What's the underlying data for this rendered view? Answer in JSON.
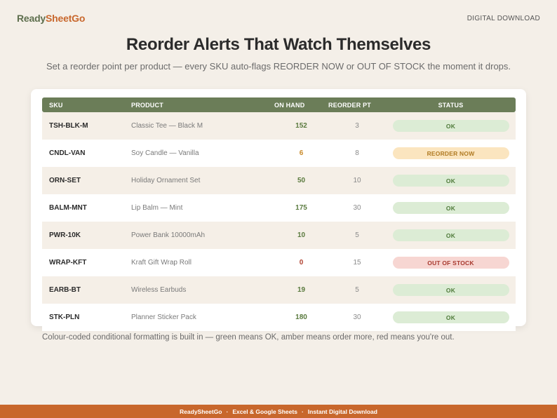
{
  "brand": {
    "part1": "Ready",
    "part2": "SheetGo"
  },
  "top_right": "DIGITAL DOWNLOAD",
  "headline": "Reorder Alerts That Watch Themselves",
  "subline": "Set a reorder point per product — every SKU auto-flags REORDER NOW or OUT OF STOCK the moment it drops.",
  "table": {
    "headers": {
      "sku": "SKU",
      "product": "PRODUCT",
      "on_hand": "ON HAND",
      "reorder_pt": "REORDER PT",
      "status": "STATUS"
    },
    "rows": [
      {
        "sku": "TSH-BLK-M",
        "product": "Classic Tee — Black M",
        "on_hand": "152",
        "reorder_pt": "3",
        "status": "OK"
      },
      {
        "sku": "CNDL-VAN",
        "product": "Soy Candle — Vanilla",
        "on_hand": "6",
        "reorder_pt": "8",
        "status": "REORDER NOW"
      },
      {
        "sku": "ORN-SET",
        "product": "Holiday Ornament Set",
        "on_hand": "50",
        "reorder_pt": "10",
        "status": "OK"
      },
      {
        "sku": "BALM-MNT",
        "product": "Lip Balm — Mint",
        "on_hand": "175",
        "reorder_pt": "30",
        "status": "OK"
      },
      {
        "sku": "PWR-10K",
        "product": "Power Bank 10000mAh",
        "on_hand": "10",
        "reorder_pt": "5",
        "status": "OK"
      },
      {
        "sku": "WRAP-KFT",
        "product": "Kraft Gift Wrap Roll",
        "on_hand": "0",
        "reorder_pt": "15",
        "status": "OUT OF STOCK"
      },
      {
        "sku": "EARB-BT",
        "product": "Wireless Earbuds",
        "on_hand": "19",
        "reorder_pt": "5",
        "status": "OK"
      },
      {
        "sku": "STK-PLN",
        "product": "Planner Sticker Pack",
        "on_hand": "180",
        "reorder_pt": "30",
        "status": "OK"
      }
    ]
  },
  "status_colors": {
    "OK": {
      "bg": "#dcecd5",
      "fg": "#4f7a3a"
    },
    "REORDER NOW": {
      "bg": "#fbe5bf",
      "fg": "#b07a22"
    },
    "OUT OF STOCK": {
      "bg": "#f7d6d2",
      "fg": "#a8392e"
    }
  },
  "on_hand_colors": {
    "OK": "#5a7a3e",
    "REORDER NOW": "#c98a2a",
    "OUT OF STOCK": "#b0402f"
  },
  "footnote": "Colour-coded conditional formatting is built in — green means OK, amber means order more, red means you're out.",
  "footer": {
    "items": [
      "ReadySheetGo",
      "Excel & Google Sheets",
      "Instant Digital Download"
    ]
  }
}
